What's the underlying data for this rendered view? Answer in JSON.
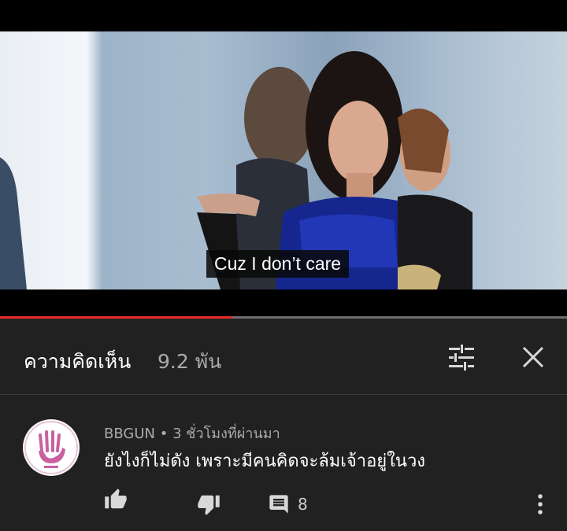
{
  "video": {
    "subtitle": "Cuz I don’t care",
    "progress": 0.41
  },
  "comments": {
    "title": "ความคิดเห็น",
    "count": "9.2 พัน"
  },
  "comment": {
    "author": "BBGUN",
    "separator": "•",
    "time": "3 ชั่วโมงที่ผ่านมา",
    "text": "ยังไงก็ไม่ดัง เพราะมีคนคิดจะล้มเจ้าอยู่ในวง",
    "reply_count": "8"
  },
  "colors": {
    "background": "#212121",
    "progress": "#e52d27",
    "avatar_logo": "#c8619f"
  },
  "icons": [
    "sort-icon",
    "close-icon",
    "like-icon",
    "dislike-icon",
    "reply-icon",
    "more-vert-icon"
  ]
}
